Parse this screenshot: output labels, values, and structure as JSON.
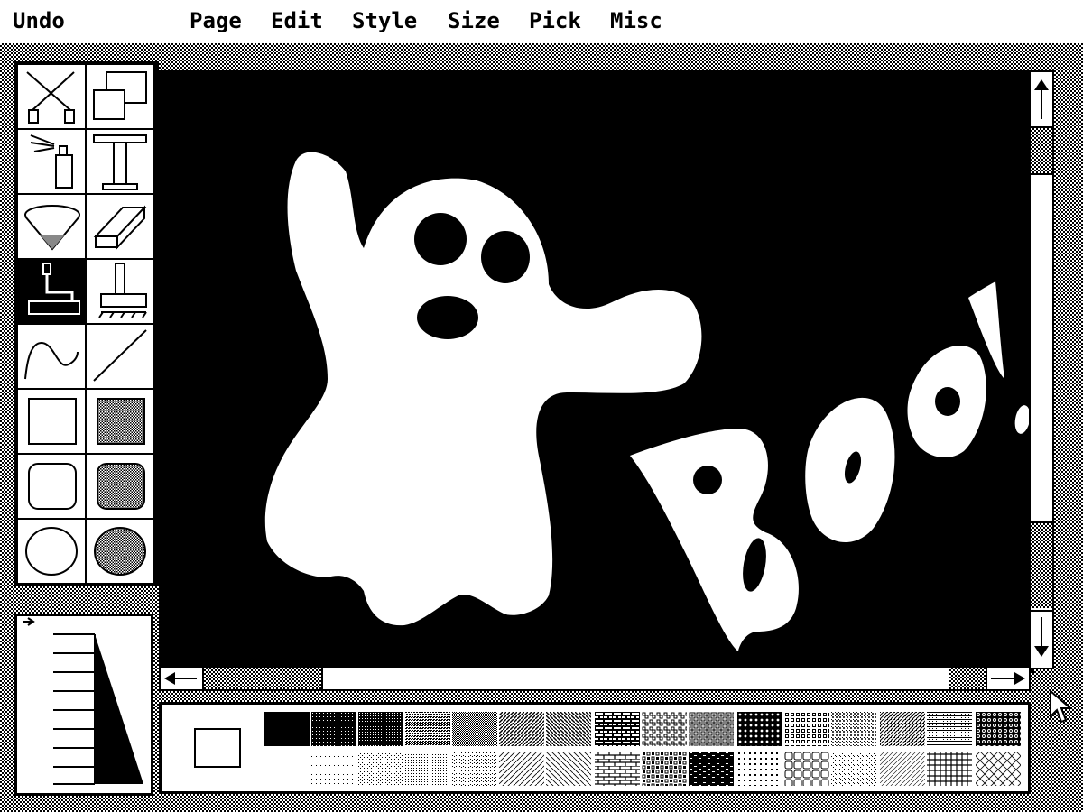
{
  "menu": {
    "undo": "Undo",
    "page": "Page",
    "edit": "Edit",
    "style": "Style",
    "size": "Size",
    "pick": "Pick",
    "misc": "Misc"
  },
  "toolbox": {
    "tools": [
      {
        "name": "selection-tool",
        "icon": "lasso-scissors-icon"
      },
      {
        "name": "copy-tool",
        "icon": "overlapping-rectangles-icon"
      },
      {
        "name": "spray-tool",
        "icon": "spray-can-icon"
      },
      {
        "name": "text-tool",
        "icon": "text-t-icon",
        "glyph": "T"
      },
      {
        "name": "fill-tool",
        "icon": "paint-bucket-icon"
      },
      {
        "name": "eraser-tool",
        "icon": "eraser-icon"
      },
      {
        "name": "roller-tool",
        "icon": "paint-roller-icon",
        "selected": true
      },
      {
        "name": "brush-tool",
        "icon": "brush-icon"
      },
      {
        "name": "curve-tool",
        "icon": "curve-icon"
      },
      {
        "name": "line-tool",
        "icon": "line-icon"
      },
      {
        "name": "rectangle-tool",
        "icon": "rectangle-icon"
      },
      {
        "name": "filled-rectangle-tool",
        "icon": "filled-rectangle-icon"
      },
      {
        "name": "rounded-rectangle-tool",
        "icon": "rounded-rectangle-icon"
      },
      {
        "name": "filled-rounded-rectangle-tool",
        "icon": "filled-rounded-rectangle-icon"
      },
      {
        "name": "ellipse-tool",
        "icon": "ellipse-icon"
      },
      {
        "name": "filled-ellipse-tool",
        "icon": "filled-ellipse-icon"
      }
    ]
  },
  "canvas": {
    "background": "#000000",
    "foreground": "#ffffff",
    "drawing_text": "BOO!"
  },
  "scrollbars": {
    "vertical": {
      "up_icon": "arrow-up-icon",
      "down_icon": "arrow-down-icon"
    },
    "horizontal": {
      "left_icon": "arrow-left-icon",
      "right_icon": "arrow-right-icon"
    }
  },
  "palette": {
    "pattern_count": 32
  },
  "colors": {
    "ink": "#000000",
    "paper": "#ffffff"
  }
}
